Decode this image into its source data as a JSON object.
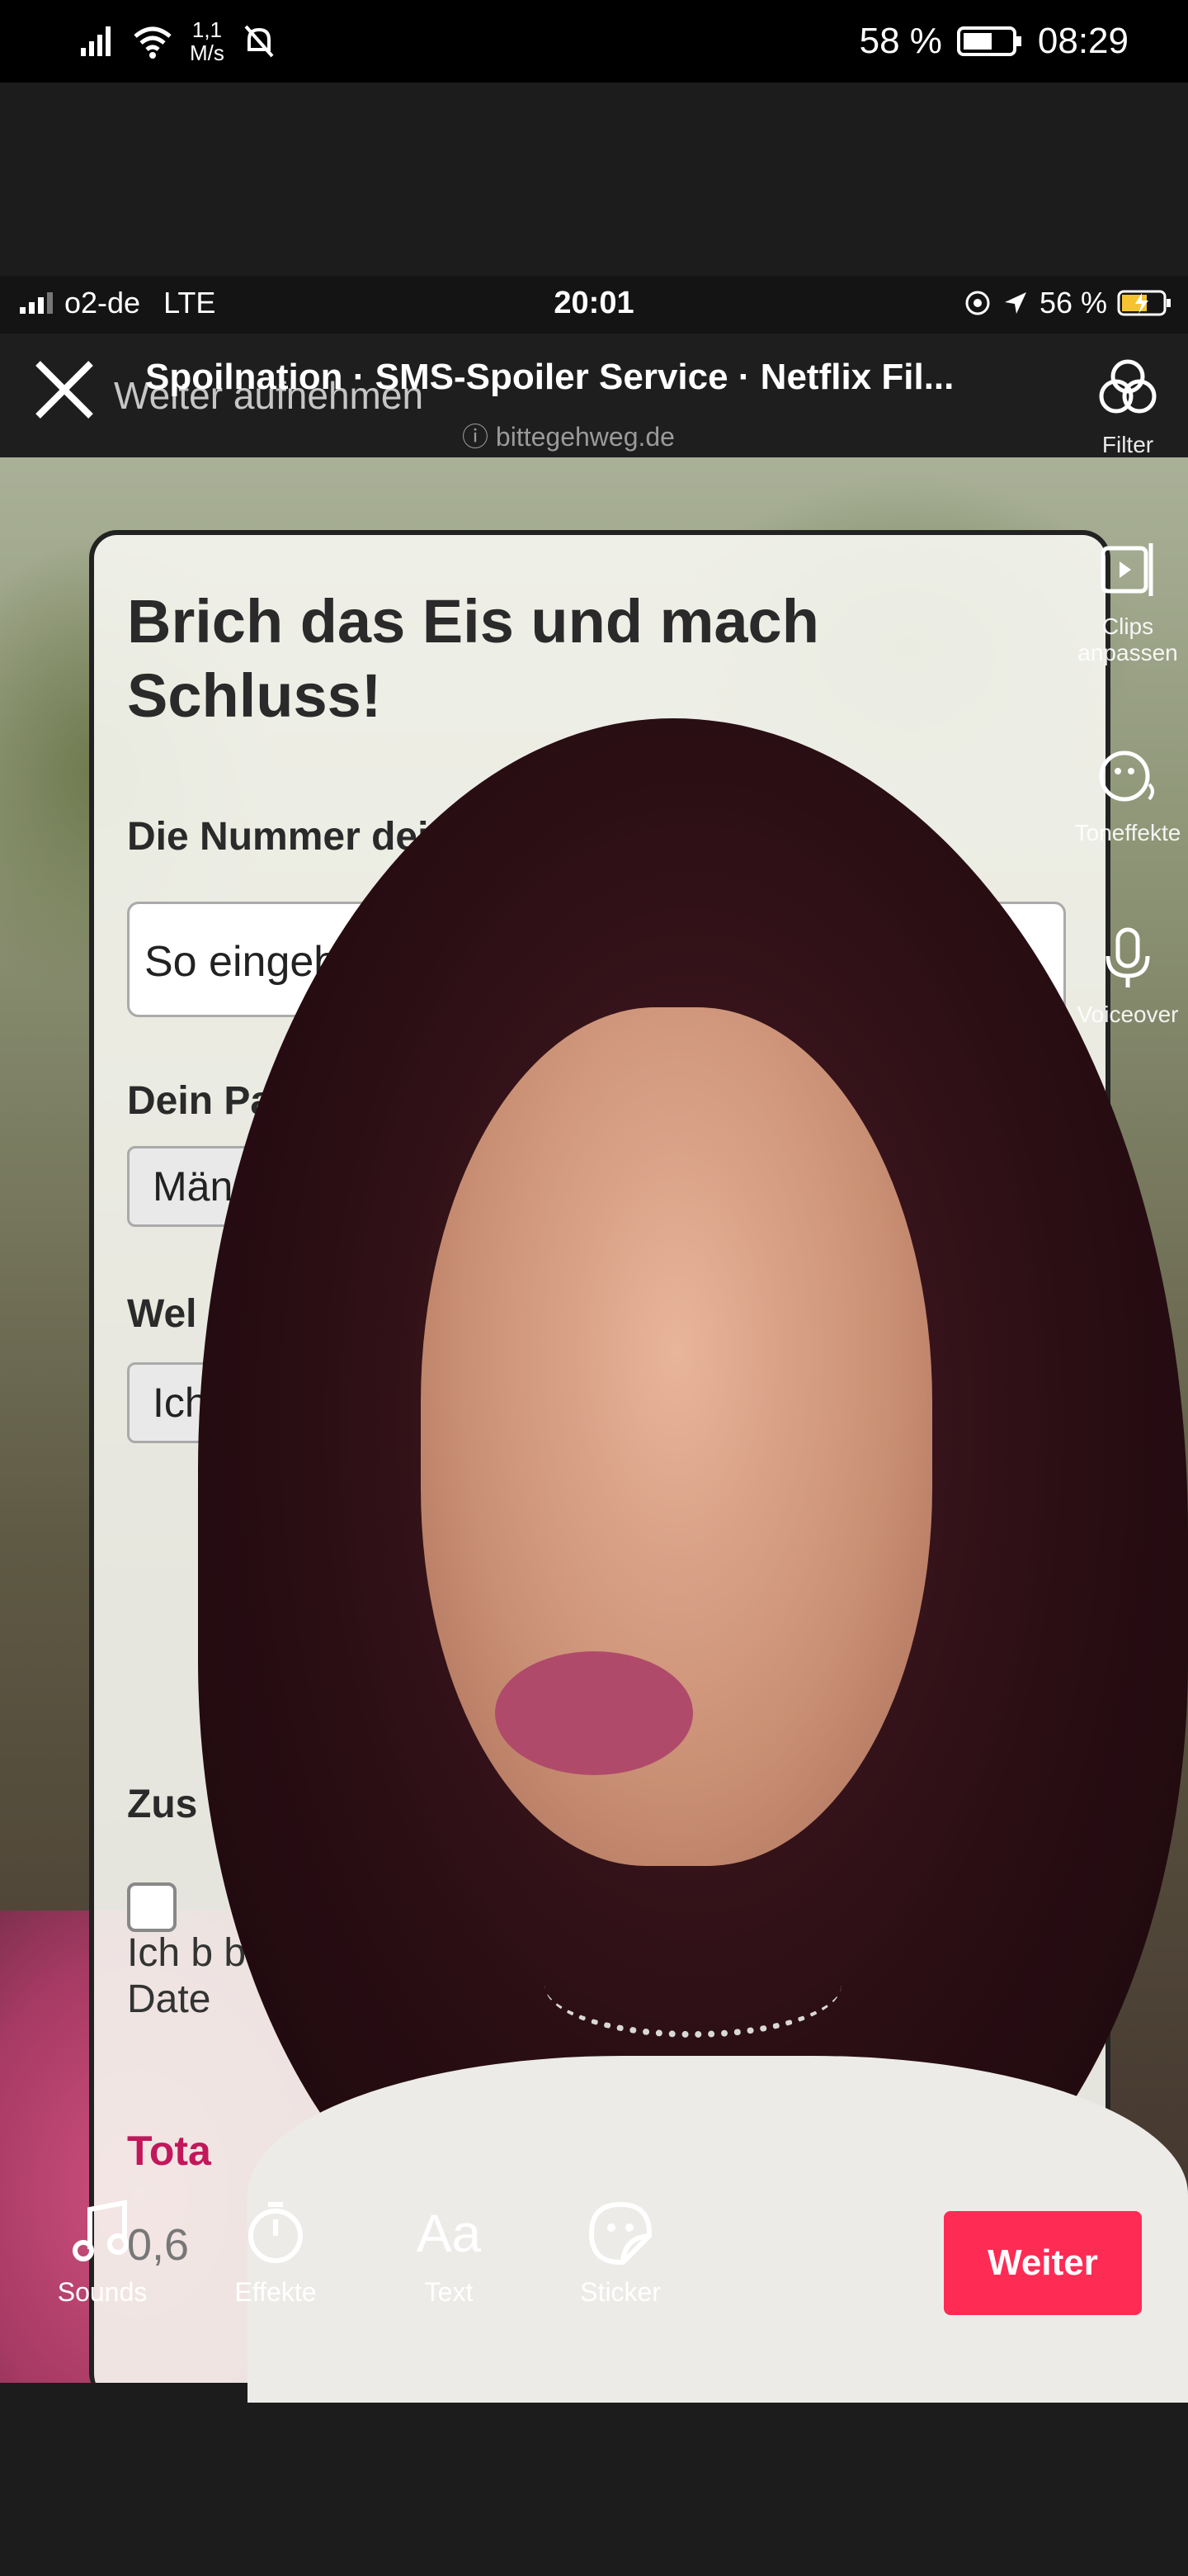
{
  "statusbar": {
    "netspeed_value": "1,1",
    "netspeed_unit": "M/s",
    "battery": "58 %",
    "time": "08:29"
  },
  "inner_status": {
    "carrier": "o2-de",
    "network": "LTE",
    "time": "20:01",
    "battery": "56 %"
  },
  "inner_header": {
    "page_title": "Spoilnation · SMS-Spoiler Service · Netflix Fil...",
    "url": "bittegehweg.de",
    "overlay_label": "Weiter aufnehmen"
  },
  "form": {
    "heading": "Brich das Eis und mach Schluss!",
    "partner_number_label": "Die Nummer deines Partners",
    "required_mark": "*",
    "partner_number_value": "So eingeben: +49123456789",
    "partner_gender_label": "Dein Partn",
    "partner_gender_value": "Männli",
    "which_label": "Wel",
    "which_value": "Ich",
    "extra_label": "Zus",
    "consent_text": "Ich b ben Date",
    "total_label": "Tota",
    "price": "0,6"
  },
  "rail": {
    "filter": "Filter",
    "clips": "Clips anpassen",
    "sound_effects": "Toneffekte",
    "voiceover": "Voiceover"
  },
  "toolbar": {
    "sounds": "Sounds",
    "effects": "Effekte",
    "text": "Text",
    "text_icon": "Aa",
    "sticker": "Sticker",
    "next": "Weiter"
  },
  "colors": {
    "accent": "#fe2c55",
    "form_accent": "#c2185b"
  }
}
